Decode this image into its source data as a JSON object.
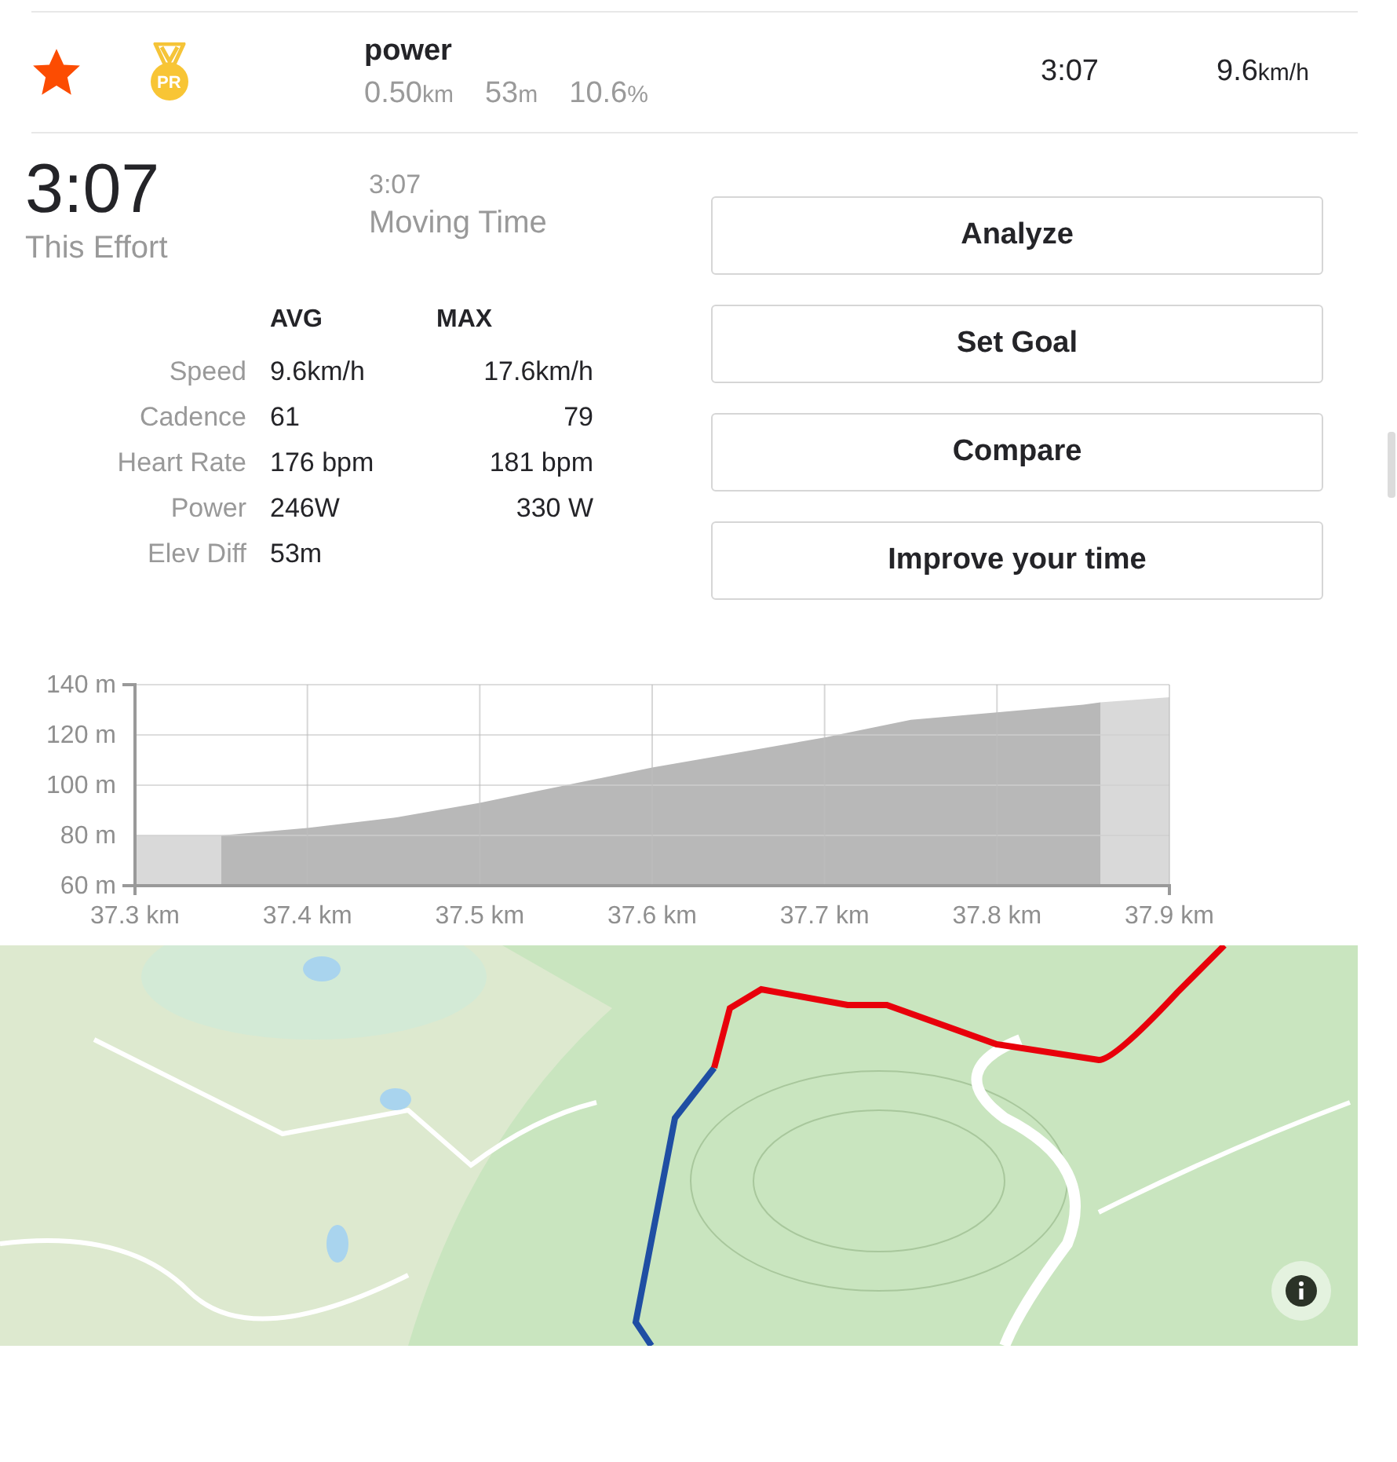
{
  "segment": {
    "starred": true,
    "badge": "PR",
    "name": "power",
    "distance": "0.50",
    "distance_unit": "km",
    "elevation": "53",
    "elevation_unit": "m",
    "grade": "10.6",
    "grade_unit": "%",
    "time": "3:07",
    "speed": "9.6",
    "speed_unit": "km/h"
  },
  "effort": {
    "time": "3:07",
    "label": "This Effort",
    "moving_time": "3:07",
    "moving_label": "Moving Time"
  },
  "stats": {
    "columns": [
      "AVG",
      "MAX"
    ],
    "rows": [
      {
        "label": "Speed",
        "avg": "9.6km/h",
        "max": "17.6km/h"
      },
      {
        "label": "Cadence",
        "avg": "61",
        "max": "79"
      },
      {
        "label": "Heart Rate",
        "avg": "176 bpm",
        "max": "181 bpm"
      },
      {
        "label": "Power",
        "avg": "246W",
        "max": "330 W"
      },
      {
        "label": "Elev Diff",
        "avg": "53m"
      }
    ]
  },
  "buttons": [
    "Analyze",
    "Set Goal",
    "Compare",
    "Improve your time"
  ],
  "elevation_chart": {
    "chart_data": {
      "type": "area",
      "x": [
        37.3,
        37.35,
        37.4,
        37.45,
        37.5,
        37.55,
        37.6,
        37.65,
        37.7,
        37.75,
        37.8,
        37.85,
        37.86,
        37.9
      ],
      "grid": true,
      "series": [
        {
          "color": "#d9d9d9",
          "values": [
            80,
            80,
            null,
            null,
            null,
            null,
            null,
            null,
            null,
            null,
            null,
            null,
            133,
            135
          ]
        },
        {
          "color": "#b8b8b8",
          "values": [
            null,
            80,
            83,
            87,
            93,
            100,
            107,
            113,
            119,
            126,
            129,
            132,
            133,
            null
          ]
        }
      ],
      "xlim": [
        37.3,
        37.9
      ],
      "ylim": [
        60,
        140
      ],
      "xticks": [
        {
          "value": 37.3,
          "label": "37.3 km"
        },
        {
          "value": 37.4,
          "label": "37.4 km"
        },
        {
          "value": 37.5,
          "label": "37.5 km"
        },
        {
          "value": 37.6,
          "label": "37.6 km"
        },
        {
          "value": 37.7,
          "label": "37.7 km"
        },
        {
          "value": 37.8,
          "label": "37.8 km"
        },
        {
          "value": 37.9,
          "label": "37.9 km"
        }
      ],
      "yticks": [
        {
          "value": 60,
          "label": "60 m"
        },
        {
          "value": 80,
          "label": "80 m"
        },
        {
          "value": 100,
          "label": "100 m"
        },
        {
          "value": 120,
          "label": "120 m"
        },
        {
          "value": 140,
          "label": "140 m"
        }
      ]
    }
  },
  "map": {
    "kind": "picture"
  }
}
